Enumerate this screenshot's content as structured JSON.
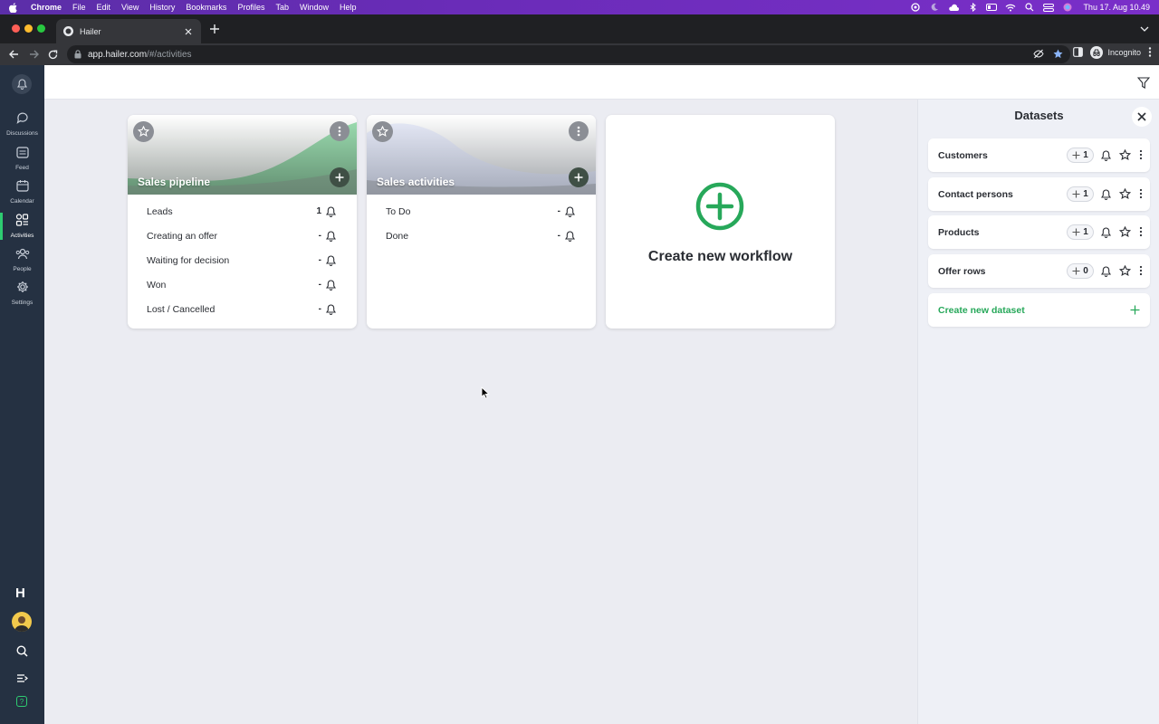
{
  "menubar": {
    "app_name": "Chrome",
    "items": [
      "File",
      "Edit",
      "View",
      "History",
      "Bookmarks",
      "Profiles",
      "Tab",
      "Window",
      "Help"
    ],
    "clock": "Thu 17. Aug  10.49"
  },
  "browser": {
    "tab_title": "Hailer",
    "url_host": "app.hailer.com",
    "url_path": "/#/activities",
    "profile_label": "Incognito"
  },
  "sidebar": {
    "items": [
      {
        "label": "Discussions",
        "icon": "discussions-icon"
      },
      {
        "label": "Feed",
        "icon": "feed-icon"
      },
      {
        "label": "Calendar",
        "icon": "calendar-icon"
      },
      {
        "label": "Activities",
        "icon": "activities-icon"
      },
      {
        "label": "People",
        "icon": "people-icon"
      },
      {
        "label": "Settings",
        "icon": "gear-icon"
      }
    ],
    "active": "Activities",
    "logo": "H",
    "help": "?"
  },
  "workflows": [
    {
      "title": "Sales pipeline",
      "phases": [
        {
          "name": "Leads",
          "count": "1"
        },
        {
          "name": "Creating an offer",
          "count": "-"
        },
        {
          "name": "Waiting for decision",
          "count": "-"
        },
        {
          "name": "Won",
          "count": "-"
        },
        {
          "name": "Lost / Cancelled",
          "count": "-"
        }
      ]
    },
    {
      "title": "Sales activities",
      "phases": [
        {
          "name": "To Do",
          "count": "-"
        },
        {
          "name": "Done",
          "count": "-"
        }
      ]
    }
  ],
  "create_workflow": {
    "label": "Create new workflow"
  },
  "datasets_panel": {
    "title": "Datasets",
    "items": [
      {
        "name": "Customers",
        "count": "1"
      },
      {
        "name": "Contact persons",
        "count": "1"
      },
      {
        "name": "Products",
        "count": "1"
      },
      {
        "name": "Offer rows",
        "count": "0"
      }
    ],
    "create_label": "Create new dataset"
  },
  "colors": {
    "accent_green": "#2ecc71",
    "sidebar_bg": "#253142",
    "app_bg": "#ebecf2"
  }
}
